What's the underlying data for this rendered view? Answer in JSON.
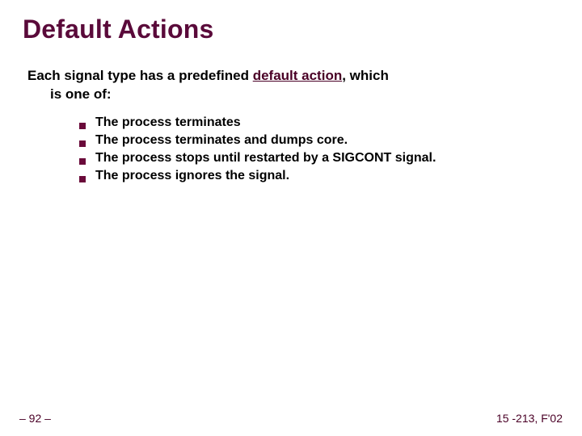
{
  "title": "Default Actions",
  "intro": {
    "before": "Each signal type has a predefined ",
    "highlight": "default action",
    "after": ", which",
    "line2": "is one of:"
  },
  "bullets": [
    "The process terminates",
    "The process terminates and dumps core.",
    "The process stops until restarted by a SIGCONT signal.",
    "The process ignores the signal."
  ],
  "footer": {
    "left": "– 92 –",
    "right": "15 -213, F'02"
  }
}
